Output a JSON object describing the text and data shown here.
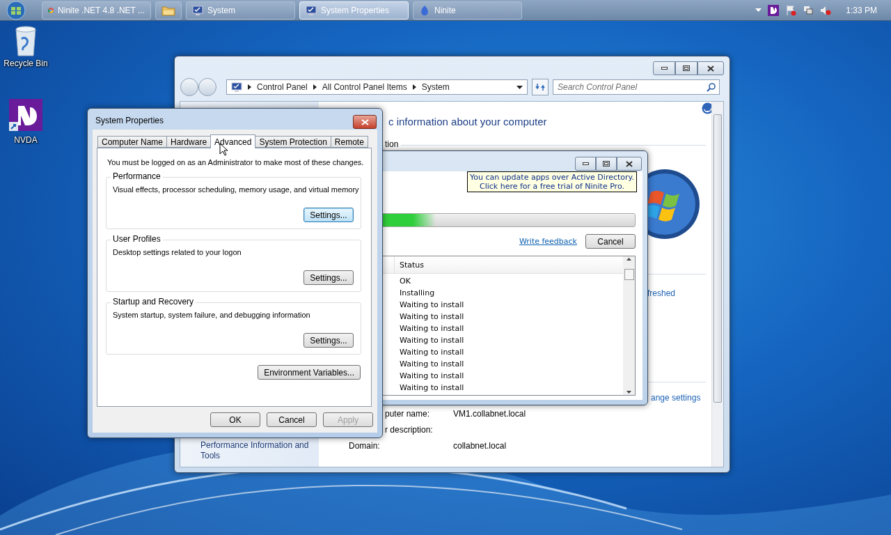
{
  "taskbar": {
    "items": [
      {
        "kind": "browser",
        "label": "Ninite .NET 4.8 .NET ...",
        "selected": false
      },
      {
        "kind": "folder",
        "selected": false
      },
      {
        "kind": "system",
        "label": "System",
        "selected": false
      },
      {
        "kind": "system",
        "label": "System Properties",
        "selected": true
      },
      {
        "kind": "ninite",
        "label": "Ninite",
        "selected": false
      }
    ],
    "clock": "1:33 PM"
  },
  "desktop_icons": [
    {
      "kind": "recycle",
      "label": "Recycle Bin"
    },
    {
      "kind": "nvda",
      "label": "NVDA"
    }
  ],
  "control_panel": {
    "breadcrumb": [
      "Control Panel",
      "All Control Panel Items",
      "System"
    ],
    "search": {
      "placeholder": "Search Control Panel"
    },
    "heading": "c information about your computer",
    "section": "tion",
    "links": [
      "freshed",
      "ange settings"
    ],
    "sidebar_link": [
      "Performance Information and",
      "Tools"
    ],
    "details": [
      {
        "label": "puter name:",
        "value": "VM1.collabnet.local"
      },
      {
        "label": "r description:"
      },
      {
        "label": "Domain:",
        "value": "collabnet.local"
      }
    ]
  },
  "ninite": {
    "banner": [
      "You can update apps over Active Directory.",
      "Click here for a free trial of Ninite Pro."
    ],
    "progress": {
      "level": 0.22
    },
    "feedback_link": "Write feedback",
    "cancel": "Cancel",
    "list": {
      "column": "Status",
      "rows": [
        "OK",
        "Installing",
        "Waiting to install",
        "Waiting to install",
        "Waiting to install",
        "Waiting to install",
        "Waiting to install",
        "Waiting to install",
        "Waiting to install",
        "Waiting to install"
      ]
    }
  },
  "system_properties": {
    "title": "System Properties",
    "tabs": [
      {
        "label": "Computer Name",
        "selected": false
      },
      {
        "label": "Hardware",
        "selected": false
      },
      {
        "label": "Advanced",
        "selected": true
      },
      {
        "label": "System Protection",
        "selected": false
      },
      {
        "label": "Remote",
        "selected": false
      }
    ],
    "notice": "You must be logged on as an Administrator to make most of these changes.",
    "groups": [
      {
        "title": "Performance",
        "text": "Visual effects, processor scheduling, memory usage, and virtual memory",
        "button": "Settings...",
        "focused": true
      },
      {
        "title": "User Profiles",
        "text": "Desktop settings related to your logon",
        "button": "Settings...",
        "focused": false
      },
      {
        "title": "Startup and Recovery",
        "text": "System startup, system failure, and debugging information",
        "button": "Settings...",
        "focused": false
      }
    ],
    "env_button": "Environment Variables...",
    "buttons": [
      {
        "label": "OK",
        "disabled": false
      },
      {
        "label": "Cancel",
        "disabled": false
      },
      {
        "label": "Apply",
        "disabled": true
      }
    ]
  }
}
